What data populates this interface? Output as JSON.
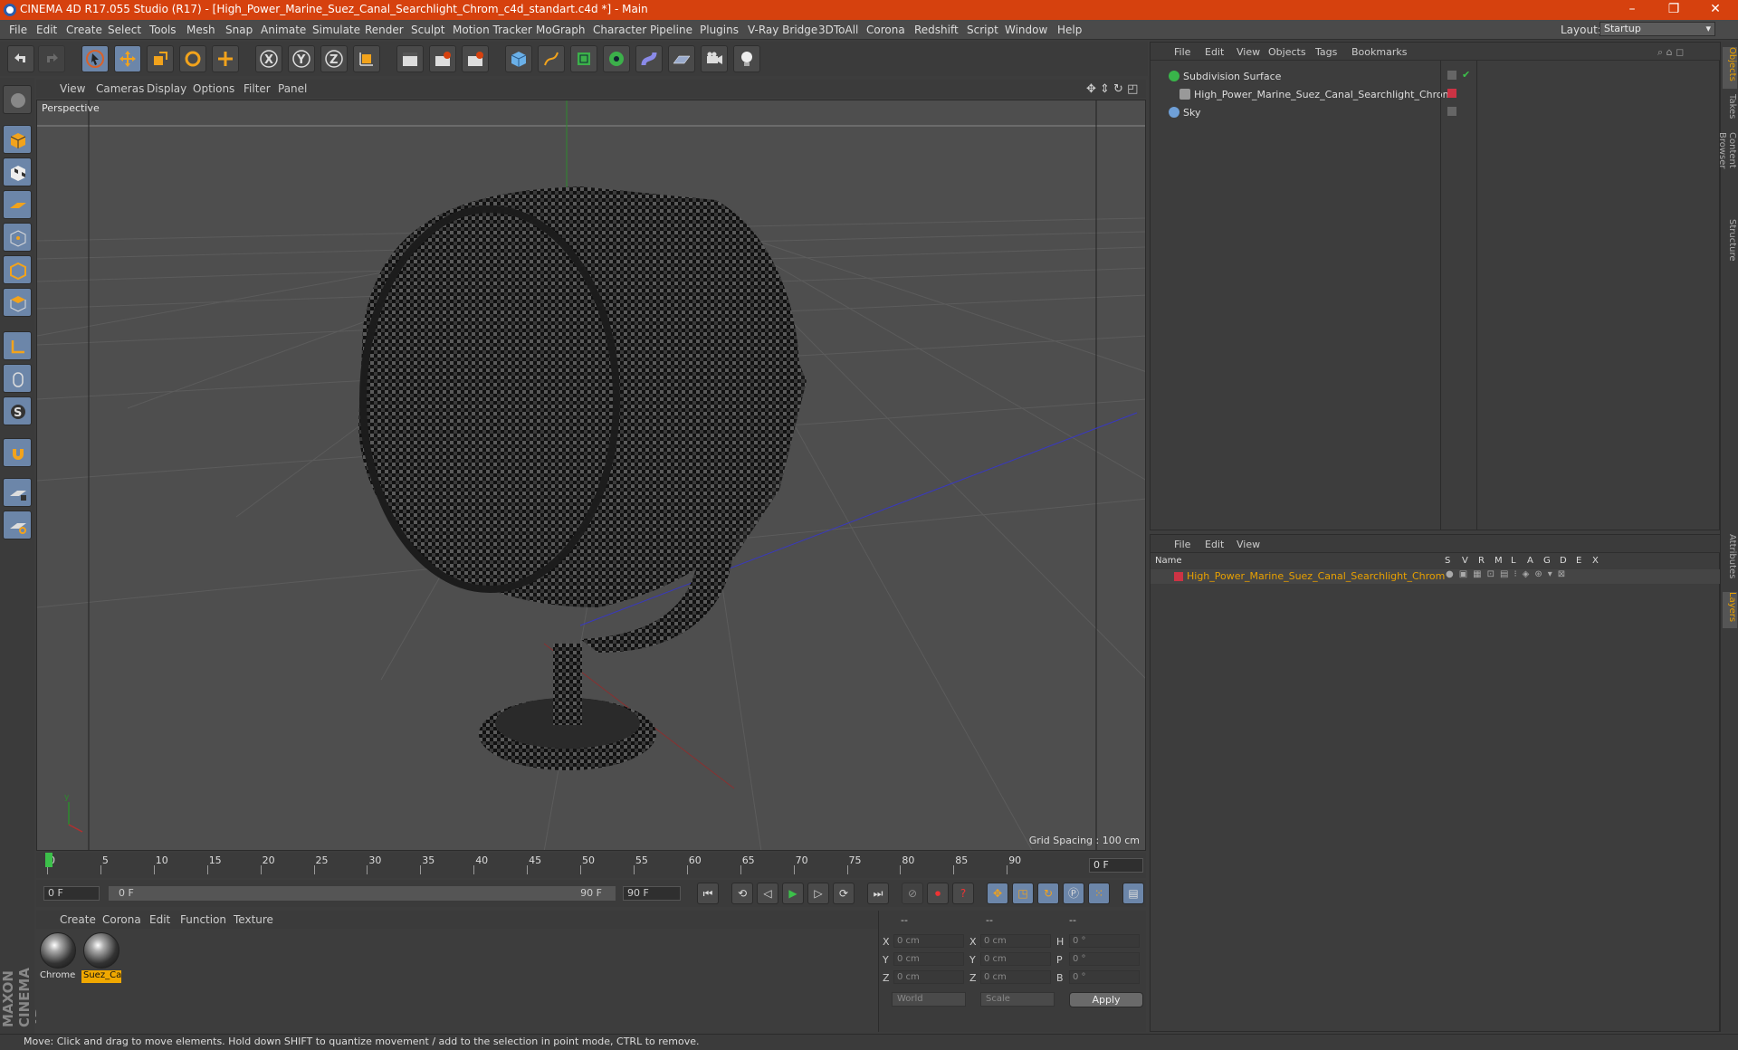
{
  "app": {
    "title": "CINEMA 4D R17.055 Studio (R17) - [High_Power_Marine_Suez_Canal_Searchlight_Chrom_c4d_standart.c4d *] - Main",
    "window_controls": [
      "–",
      "❐",
      "✕"
    ]
  },
  "menubar": {
    "items": [
      "File",
      "Edit",
      "Create",
      "Select",
      "Tools",
      "Mesh",
      "Snap",
      "Animate",
      "Simulate",
      "Render",
      "Sculpt",
      "Motion Tracker",
      "MoGraph",
      "Character",
      "Pipeline",
      "Plugins",
      "V-Ray Bridge",
      "3DToAll",
      "Corona",
      "Redshift",
      "Script",
      "Window",
      "Help"
    ],
    "layout_label": "Layout:",
    "layout_value": "Startup"
  },
  "viewport": {
    "menu": [
      "View",
      "Cameras",
      "Display",
      "Options",
      "Filter",
      "Panel"
    ],
    "label": "Perspective",
    "grid_spacing": "Grid Spacing : 100 cm"
  },
  "timeline": {
    "ticks": [
      "0",
      "5",
      "10",
      "15",
      "20",
      "25",
      "30",
      "35",
      "40",
      "45",
      "50",
      "55",
      "60",
      "65",
      "70",
      "75",
      "80",
      "85",
      "90"
    ],
    "current_frame_right": "0 F",
    "start_field": "0 F",
    "range_start": "0 F",
    "range_end": "90 F",
    "end_field": "90 F"
  },
  "materials": {
    "menu": [
      "Create",
      "Corona",
      "Edit",
      "Function",
      "Texture"
    ],
    "items": [
      {
        "name": "Chrome",
        "selected": false
      },
      {
        "name": "Suez_Ca",
        "selected": true
      }
    ]
  },
  "coordinates": {
    "headers": [
      "--",
      "--",
      "--"
    ],
    "rows": [
      {
        "axis": "X",
        "pos": "0 cm",
        "axis2": "X",
        "size": "0 cm",
        "rot_axis": "H",
        "rot": "0 °"
      },
      {
        "axis": "Y",
        "pos": "0 cm",
        "axis2": "Y",
        "size": "0 cm",
        "rot_axis": "P",
        "rot": "0 °"
      },
      {
        "axis": "Z",
        "pos": "0 cm",
        "axis2": "Z",
        "size": "0 cm",
        "rot_axis": "B",
        "rot": "0 °"
      }
    ],
    "space": "World",
    "mode": "Scale",
    "apply": "Apply"
  },
  "objects": {
    "menu": [
      "File",
      "Edit",
      "View",
      "Objects",
      "Tags",
      "Bookmarks"
    ],
    "rows": [
      {
        "name": "Subdivision Surface",
        "color": "#39b54a"
      },
      {
        "name": "High_Power_Marine_Suez_Canal_Searchlight_Chrom",
        "color": "#cc3344"
      },
      {
        "name": "Sky",
        "color": "#6fa0d8"
      }
    ]
  },
  "layers": {
    "menu": [
      "File",
      "Edit",
      "View"
    ],
    "columns": [
      "Name",
      "S",
      "V",
      "R",
      "M",
      "L",
      "A",
      "G",
      "D",
      "E",
      "X"
    ],
    "row_name": "High_Power_Marine_Suez_Canal_Searchlight_Chrom",
    "row_color": "#e8a000"
  },
  "right_tabs": [
    "Objects",
    "Takes",
    "Content Browser",
    "Structure",
    "Attributes",
    "Layers"
  ],
  "status": "Move: Click and drag to move elements. Hold down SHIFT to quantize movement / add to the selection in point mode, CTRL to remove.",
  "branding": "MAXON CINEMA 4D"
}
